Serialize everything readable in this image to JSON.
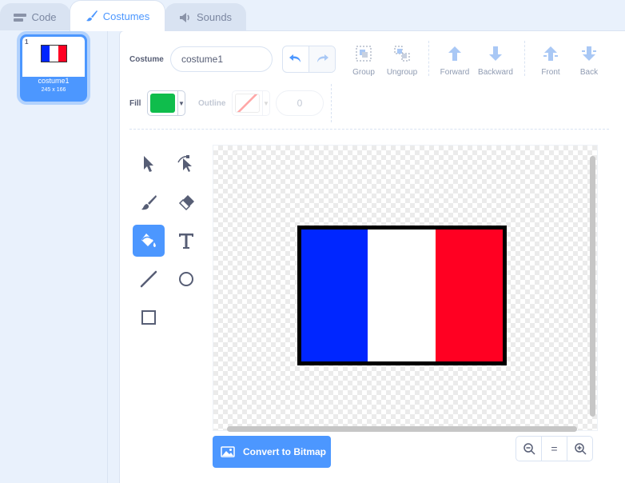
{
  "tabs": [
    {
      "label": "Code",
      "icon": "code-icon"
    },
    {
      "label": "Costumes",
      "icon": "brush-icon",
      "active": true
    },
    {
      "label": "Sounds",
      "icon": "speaker-icon"
    }
  ],
  "costume_list": [
    {
      "number": "1",
      "name": "costume1",
      "size": "245 x 166",
      "selected": true
    }
  ],
  "toolbar": {
    "costume_label": "Costume",
    "costume_name": "costume1",
    "group_label": "Group",
    "ungroup_label": "Ungroup",
    "forward_label": "Forward",
    "backward_label": "Backward",
    "front_label": "Front",
    "back_label": "Back",
    "fill_label": "Fill",
    "outline_label": "Outline",
    "outline_width": "0"
  },
  "colors": {
    "accent": "#4c97ff",
    "fill": "#0fbd4c",
    "flag_blue": "#0026ff",
    "flag_white": "#ffffff",
    "flag_red": "#ff0022",
    "flag_border": "#000000"
  },
  "tools": [
    {
      "name": "select-tool",
      "icon": "arrow-icon"
    },
    {
      "name": "reshape-tool",
      "icon": "reshape-icon"
    },
    {
      "name": "brush-tool",
      "icon": "brush-icon"
    },
    {
      "name": "eraser-tool",
      "icon": "eraser-icon"
    },
    {
      "name": "fill-tool",
      "icon": "fill-bucket-icon",
      "active": true
    },
    {
      "name": "text-tool",
      "icon": "text-icon"
    },
    {
      "name": "line-tool",
      "icon": "line-icon"
    },
    {
      "name": "circle-tool",
      "icon": "circle-icon"
    },
    {
      "name": "rectangle-tool",
      "icon": "rectangle-icon"
    }
  ],
  "canvas": {
    "convert_label": "Convert to Bitmap",
    "zoom_reset_label": "="
  }
}
